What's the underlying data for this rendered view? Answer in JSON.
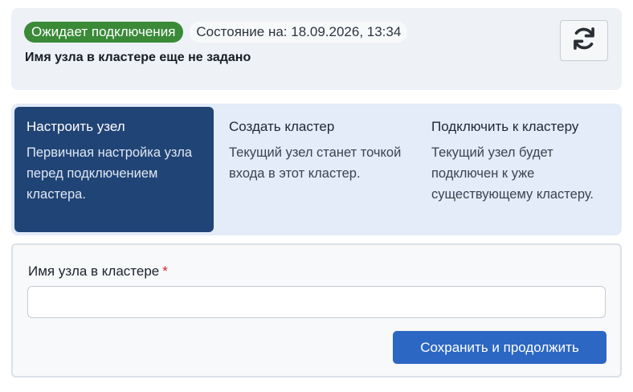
{
  "status": {
    "badge": "Ожидает подключения",
    "timestamp": "Состояние на: 18.09.2026, 13:34",
    "node_name_note": "Имя узла в кластере еще не задано",
    "refresh_icon": "refresh-icon"
  },
  "steps": [
    {
      "title": "Настроить узел",
      "description": "Первичная настройка узла перед подключением кластера.",
      "active": true
    },
    {
      "title": "Создать кластер",
      "description": "Текущий узел станет точкой входа в этот кластер.",
      "active": false
    },
    {
      "title": "Подключить к кластеру",
      "description": "Текущий узел будет подключен к уже существующему кластеру.",
      "active": false
    }
  ],
  "form": {
    "field_label": "Имя узла в кластере",
    "required_mark": "*",
    "input_value": "",
    "save_label": "Сохранить и продолжить"
  },
  "colors": {
    "badge": "#3a8a38",
    "active_step": "#214476",
    "primary_button": "#2d67c4",
    "required": "#c9252c"
  }
}
